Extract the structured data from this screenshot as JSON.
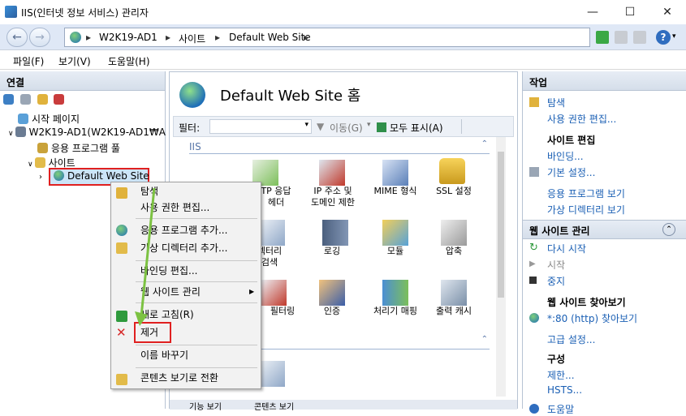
{
  "window": {
    "title": "IIS(인터넷 정보 서비스) 관리자",
    "min": "—",
    "max": "☐",
    "close": "✕"
  },
  "address": {
    "parts": [
      "W2K19-AD1",
      "사이트",
      "Default Web Site"
    ],
    "sep": "▸"
  },
  "menu": [
    "파일(F)",
    "보기(V)",
    "도움말(H)"
  ],
  "connections": {
    "header": "연결",
    "tree": [
      "시작 페이지",
      "W2K19-AD1(W2K19-AD1₩A",
      "응용 프로그램 풀",
      "사이트",
      "Default Web Site"
    ]
  },
  "center": {
    "title": "Default Web Site 홈",
    "filter_label": "필터:",
    "go_label": "이동(G)",
    "showall_label": "모두 표시(A)",
    "group": "IIS",
    "icons": [
      "HTTP 응답 헤더",
      "IP 주소 및 도메인 제한",
      "MIME 형식",
      "SSL 설정",
      "디렉터리 검색",
      "로깅",
      "모듈",
      "압축",
      "필터링",
      "인증",
      "처리기 매핑",
      "출력 캐시"
    ],
    "icon_partial": [
      "TP 응답",
      "헤더",
      "렉터리",
      "검색",
      "필터링"
    ],
    "bottom_tabs": [
      "기능 보기",
      "콘텐츠 보기"
    ]
  },
  "context_menu": [
    "탐색",
    "사용 권한 편집...",
    "응용 프로그램 추가...",
    "가상 디렉터리 추가...",
    "바인딩 편집...",
    "웹 사이트 관리",
    "새로 고침(R)",
    "제거",
    "이름 바꾸기",
    "콘텐츠 보기로 전환"
  ],
  "actions": {
    "header": "작업",
    "a1": "탐색",
    "a2": "사용 권한 편집...",
    "site_edit": "사이트 편집",
    "a3": "바인딩...",
    "a4": "기본 설정...",
    "a5": "응용 프로그램 보기",
    "a6": "가상 디렉터리 보기",
    "manage": "웹 사이트 관리",
    "restart": "다시 시작",
    "start": "시작",
    "stop": "중지",
    "browse": "웹 사이트 찾아보기",
    "browse_link": "*:80 (http) 찾아보기",
    "advanced": "고급 설정...",
    "config": "구성",
    "limit": "제한...",
    "hsts": "HSTS...",
    "help": "도움말"
  },
  "colors": {
    "accent": "#1a5fb4",
    "highlight_box": "#e02020",
    "arrow": "#7cc242"
  }
}
